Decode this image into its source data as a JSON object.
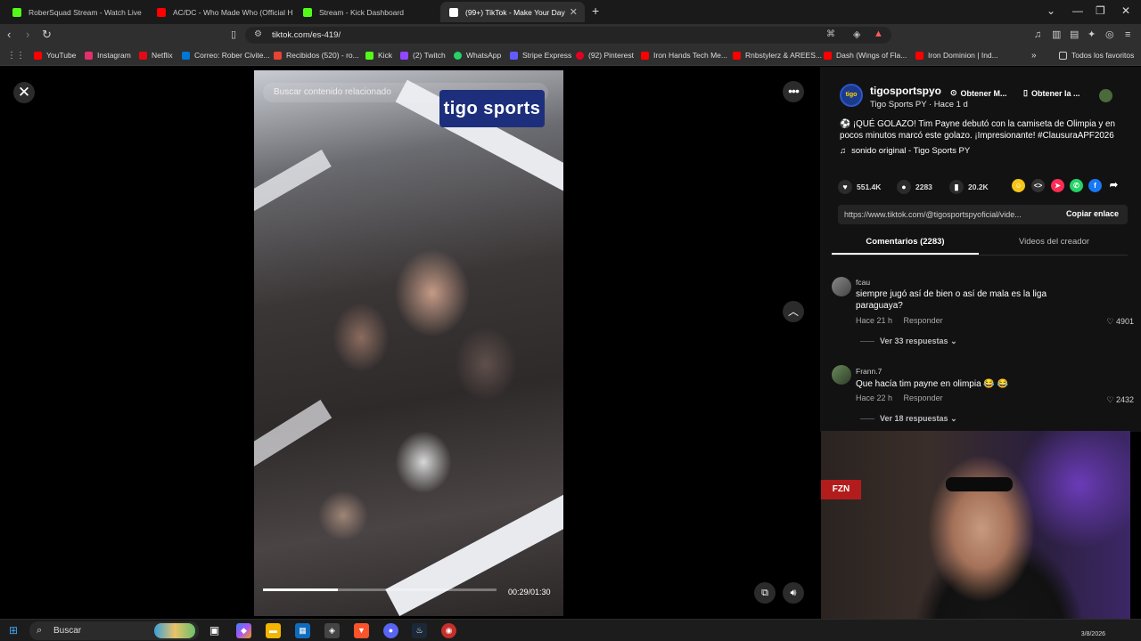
{
  "browser": {
    "tabs": [
      {
        "title": "RoberSquad Stream - Watch Live",
        "color": "#53fc18"
      },
      {
        "title": "AC/DC - Who Made Who (Official HD",
        "color": "#ff0000"
      },
      {
        "title": "Stream - Kick Dashboard",
        "color": "#53fc18"
      },
      {
        "title": "(99+) TikTok - Make Your Day",
        "color": "#ffffff"
      }
    ],
    "url": "tiktok.com/es-419/",
    "bookmarks": [
      {
        "label": "YouTube",
        "color": "#ff0000"
      },
      {
        "label": "Instagram",
        "color": "#e1306c"
      },
      {
        "label": "Netflix",
        "color": "#e50914"
      },
      {
        "label": "Correo: Rober Civite...",
        "color": "#0078d4"
      },
      {
        "label": "Recibidos (520) - ro...",
        "color": "#ea4335"
      },
      {
        "label": "Kick",
        "color": "#53fc18"
      },
      {
        "label": "(2) Twitch",
        "color": "#9146ff"
      },
      {
        "label": "WhatsApp",
        "color": "#25d366"
      },
      {
        "label": "Stripe Express",
        "color": "#635bff"
      },
      {
        "label": "(92) Pinterest",
        "color": "#e60023"
      },
      {
        "label": "Iron Hands Tech Me...",
        "color": "#ff0000"
      },
      {
        "label": "Rnbstylerz & AREES...",
        "color": "#ff0000"
      },
      {
        "label": "Dash (Wings of Fla...",
        "color": "#ff0000"
      },
      {
        "label": "Iron Dominion | Ind...",
        "color": "#ff0000"
      }
    ],
    "all_bookmarks": "Todos los favoritos"
  },
  "video": {
    "search_placeholder": "Buscar contenido relacionado",
    "brand_logo": "tigo sports",
    "time": "00:29/01:30",
    "progress": 0.32
  },
  "post": {
    "author": "tigosportspyo",
    "author_sub": "Tigo Sports PY · Hace 1 d",
    "avatar_text": "tigo",
    "get_app_1": "Obtener M...",
    "get_app_2": "Obtener la ...",
    "caption": "⚽ ¡QUÉ GOLAZO! Tim Payne debutó con la camiseta de Olimpia y en pocos minutos marcó este golazo. ¡Impresionante! #ClausuraAPF2026",
    "sound": "sonido original - Tigo Sports PY",
    "likes": "551.4K",
    "comments": "2283",
    "saves": "20.2K",
    "link": "https://www.tiktok.com/@tigosportspyoficial/vide...",
    "copy_label": "Copiar enlace",
    "tab_comments": "Comentarios (2283)",
    "tab_videos": "Videos del creador"
  },
  "comments": [
    {
      "user": "fcau",
      "text": "siempre jugó así de bien o así de mala es la liga paraguaya?",
      "time": "Hace 21 h",
      "reply": "Responder",
      "likes": "4901",
      "replies": "Ver 33 respuestas"
    },
    {
      "user": "Frann.7",
      "text": "Que hacía tim payne en olimpia 😂 😂",
      "time": "Hace 22 h",
      "reply": "Responder",
      "likes": "2432",
      "replies": "Ver 18 respuestas"
    }
  ],
  "taskbar": {
    "search": "Buscar",
    "date": "3/8/2026"
  },
  "webcam": {
    "sign": "FZN"
  }
}
